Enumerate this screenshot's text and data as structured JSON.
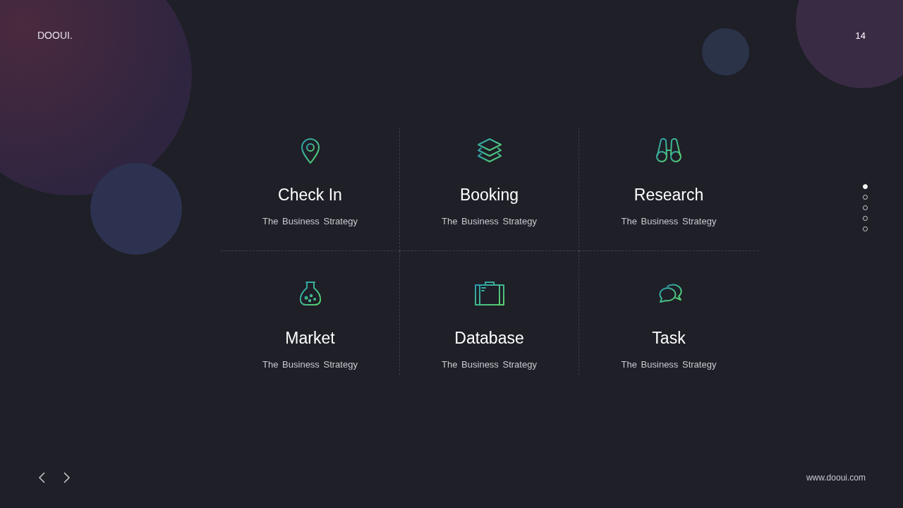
{
  "brand": "DOOUI.",
  "page_number": "14",
  "features": [
    {
      "title": "Check In",
      "subtitle": "The Business Strategy"
    },
    {
      "title": "Booking",
      "subtitle": "The Business Strategy"
    },
    {
      "title": "Research",
      "subtitle": "The Business Strategy"
    },
    {
      "title": "Market",
      "subtitle": "The Business Strategy"
    },
    {
      "title": "Database",
      "subtitle": "The Business Strategy"
    },
    {
      "title": "Task",
      "subtitle": "The Business Strategy"
    }
  ],
  "pagination": [
    {
      "selected": true
    },
    {
      "selected": false
    },
    {
      "selected": false
    },
    {
      "selected": false
    },
    {
      "selected": false
    }
  ],
  "website": "www.dooui.com"
}
